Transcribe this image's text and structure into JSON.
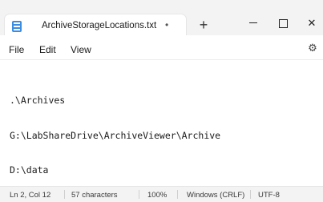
{
  "tab": {
    "title": "ArchiveStorageLocations.txt",
    "modified_indicator": "•",
    "new_tab_label": "+"
  },
  "window_controls": {
    "close_label": "✕"
  },
  "menu": {
    "items": [
      {
        "label": "File"
      },
      {
        "label": "Edit"
      },
      {
        "label": "View"
      }
    ],
    "settings_icon": "gear-icon"
  },
  "editor": {
    "lines": [
      ".\\Archives",
      "G:\\LabShareDrive\\ArchiveViewer\\Archive",
      "D:\\data"
    ]
  },
  "status": {
    "position": "Ln 2, Col 12",
    "characters": "57 characters",
    "zoom": "100%",
    "line_ending": "Windows (CRLF)",
    "encoding": "UTF-8"
  },
  "colors": {
    "titlebar_bg": "#f3f3f3",
    "accent_icon": "#3b8de0"
  }
}
